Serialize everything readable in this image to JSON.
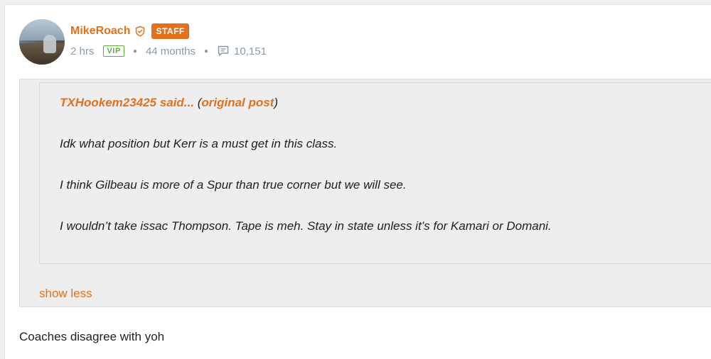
{
  "post": {
    "author": {
      "username": "MikeRoach",
      "badge": "STAFF",
      "membership": "VIP",
      "posted_ago": "2 hrs",
      "member_for": "44 months",
      "post_count": "10,151"
    },
    "quote": {
      "quoted_user": "TXHookem23425 said...",
      "open_paren": " (",
      "original_link": "original post",
      "close_paren": ")",
      "lines": [
        "Idk what position but Kerr is a must get in this class.",
        "I think Gilbeau is more of a Spur than true corner but we will see.",
        "I wouldn’t take issac Thompson. Tape is meh. Stay in state unless it’s for Kamari or Domani."
      ],
      "show_less": "show less"
    },
    "body": "Coaches disagree with yoh"
  },
  "icons": {
    "verified": "shield-check-icon",
    "comments": "comment-icon"
  },
  "colors": {
    "accent": "#e2711d",
    "vip": "#5cae3a",
    "meta": "#8a9aa8"
  }
}
